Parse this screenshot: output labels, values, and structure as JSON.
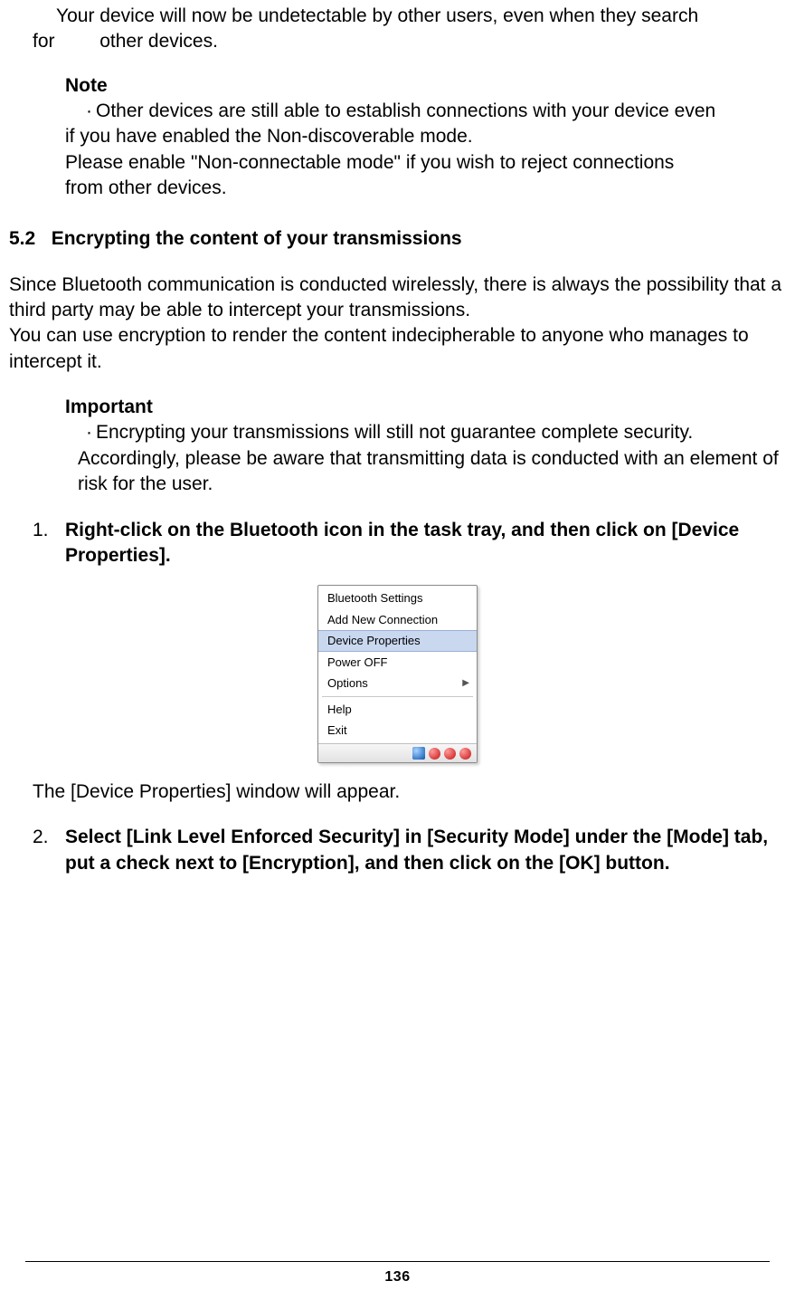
{
  "intro": {
    "line1": "Your device will now be undetectable by other users, even when they search",
    "line2_prefix": "for",
    "line2_rest": "other devices."
  },
  "note": {
    "heading": "Note",
    "bullet_symbol": "·",
    "line1": "Other devices are still able to establish connections with your device even",
    "line2": "if you  have enabled the Non-discoverable mode.",
    "line3": "Please enable \"Non-connectable mode\" if you wish to reject connections",
    "line4": "from    other devices."
  },
  "section": {
    "number": "5.2",
    "title": "Encrypting the content of your transmissions"
  },
  "body1": {
    "p1": "Since Bluetooth communication is conducted wirelessly, there is always the possibility that a third party may be able to intercept your transmissions.",
    "p2": "You can use encryption to render the content indecipherable to anyone who manages to intercept it."
  },
  "important": {
    "heading": "Important",
    "bullet_symbol": "·",
    "line1": "Encrypting your transmissions will still not guarantee complete security.",
    "line2": "Accordingly, please be aware that transmitting data is conducted with an element of risk for the user."
  },
  "steps": {
    "s1": {
      "num": "1.",
      "text": "Right-click on the Bluetooth icon in the task tray, and then click on [Device Properties]."
    },
    "after_s1": "The [Device Properties] window will appear.",
    "s2": {
      "num": "2.",
      "text": "Select [Link Level Enforced Security] in [Security Mode] under the [Mode] tab, put a check next to [Encryption], and then click on the [OK] button."
    }
  },
  "context_menu": {
    "items": [
      "Bluetooth Settings",
      "Add New Connection",
      "Device Properties",
      "Power OFF",
      "Options",
      "Help",
      "Exit"
    ],
    "highlighted_index": 2,
    "submenu_index": 4
  },
  "page_number": "136"
}
